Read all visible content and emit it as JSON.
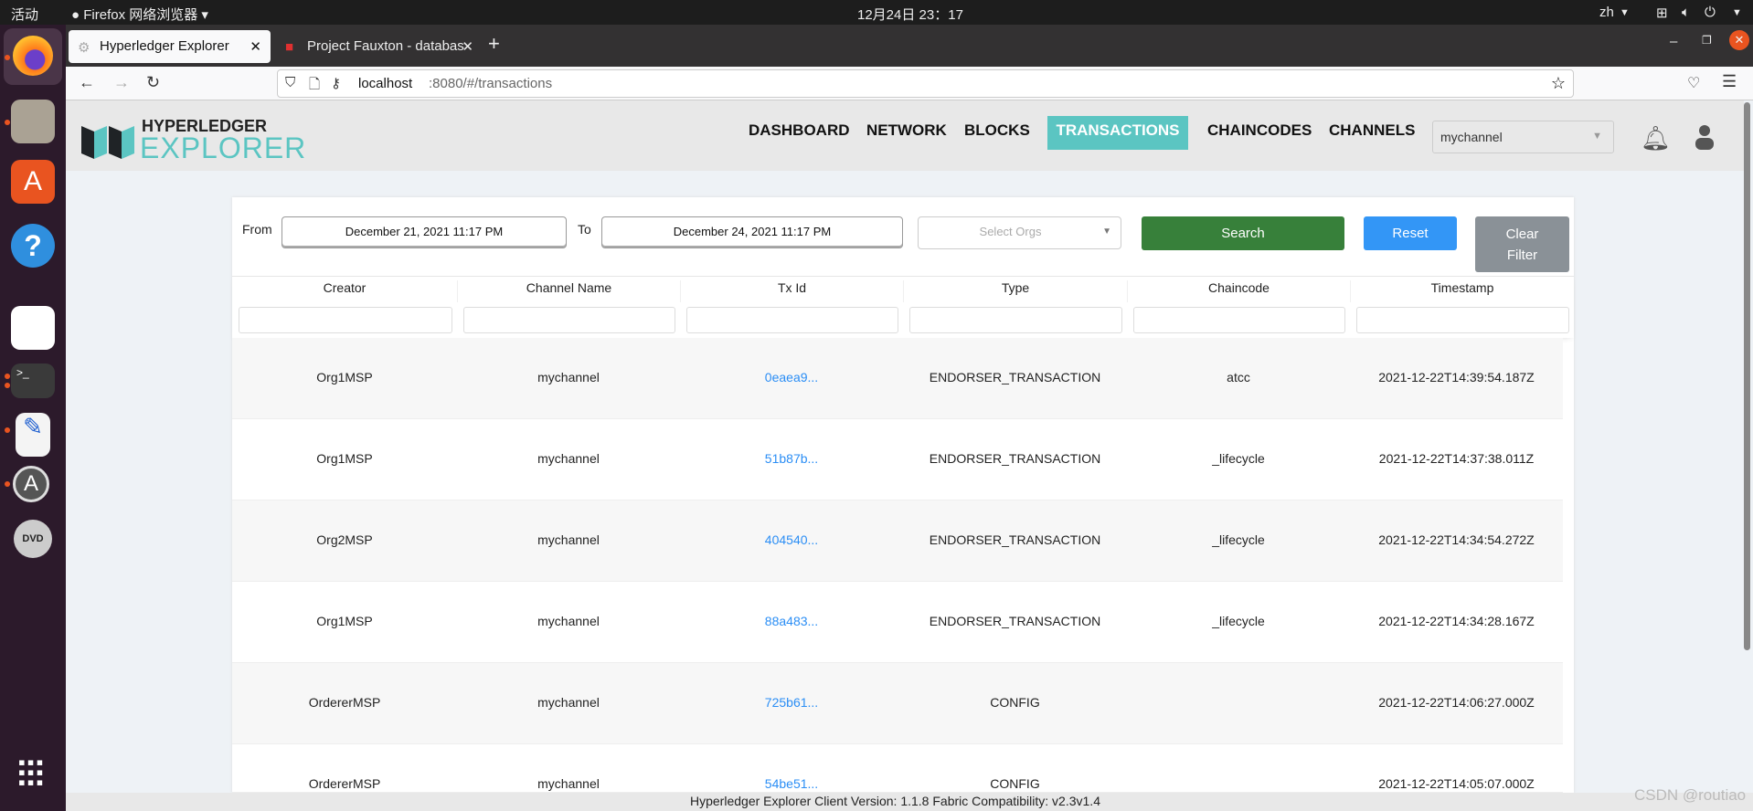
{
  "os": {
    "activities": "活动",
    "app_menu": "Firefox 网络浏览器",
    "clock": "12月24日  23：17",
    "lang": "zh"
  },
  "browser": {
    "tabs": [
      {
        "label": "Hyperledger Explorer"
      },
      {
        "label": "Project Fauxton - databas"
      }
    ],
    "url_host": "localhost",
    "url_rest": ":8080/#/transactions"
  },
  "app": {
    "logo_top": "HYPERLEDGER",
    "logo_bottom": "EXPLORER",
    "nav": [
      "DASHBOARD",
      "NETWORK",
      "BLOCKS",
      "TRANSACTIONS",
      "CHAINCODES",
      "CHANNELS"
    ],
    "active_nav": "TRANSACTIONS",
    "accent": "#5bc5c2",
    "channel_select": "mychannel"
  },
  "filters": {
    "from_label": "From",
    "from_value": "December 21, 2021 11:17 PM",
    "to_label": "To",
    "to_value": "December 24, 2021 11:17 PM",
    "orgs_placeholder": "Select Orgs",
    "search": "Search",
    "reset": "Reset",
    "clear_filter_1": "Clear",
    "clear_filter_2": "Filter"
  },
  "table": {
    "columns": [
      "Creator",
      "Channel Name",
      "Tx Id",
      "Type",
      "Chaincode",
      "Timestamp"
    ],
    "rows": [
      [
        "Org1MSP",
        "mychannel",
        "0eaea9...",
        "ENDORSER_TRANSACTION",
        "atcc",
        "2021-12-22T14:39:54.187Z"
      ],
      [
        "Org1MSP",
        "mychannel",
        "51b87b...",
        "ENDORSER_TRANSACTION",
        "_lifecycle",
        "2021-12-22T14:37:38.011Z"
      ],
      [
        "Org2MSP",
        "mychannel",
        "404540...",
        "ENDORSER_TRANSACTION",
        "_lifecycle",
        "2021-12-22T14:34:54.272Z"
      ],
      [
        "Org1MSP",
        "mychannel",
        "88a483...",
        "ENDORSER_TRANSACTION",
        "_lifecycle",
        "2021-12-22T14:34:28.167Z"
      ],
      [
        "OrdererMSP",
        "mychannel",
        "725b61...",
        "CONFIG",
        "",
        "2021-12-22T14:06:27.000Z"
      ],
      [
        "OrdererMSP",
        "mychannel",
        "54be51...",
        "CONFIG",
        "",
        "2021-12-22T14:05:07.000Z"
      ]
    ]
  },
  "footer": {
    "text": "Hyperledger Explorer Client Version: 1.1.8   Fabric Compatibility: v2.3v1.4",
    "watermark": "CSDN @routiao"
  }
}
